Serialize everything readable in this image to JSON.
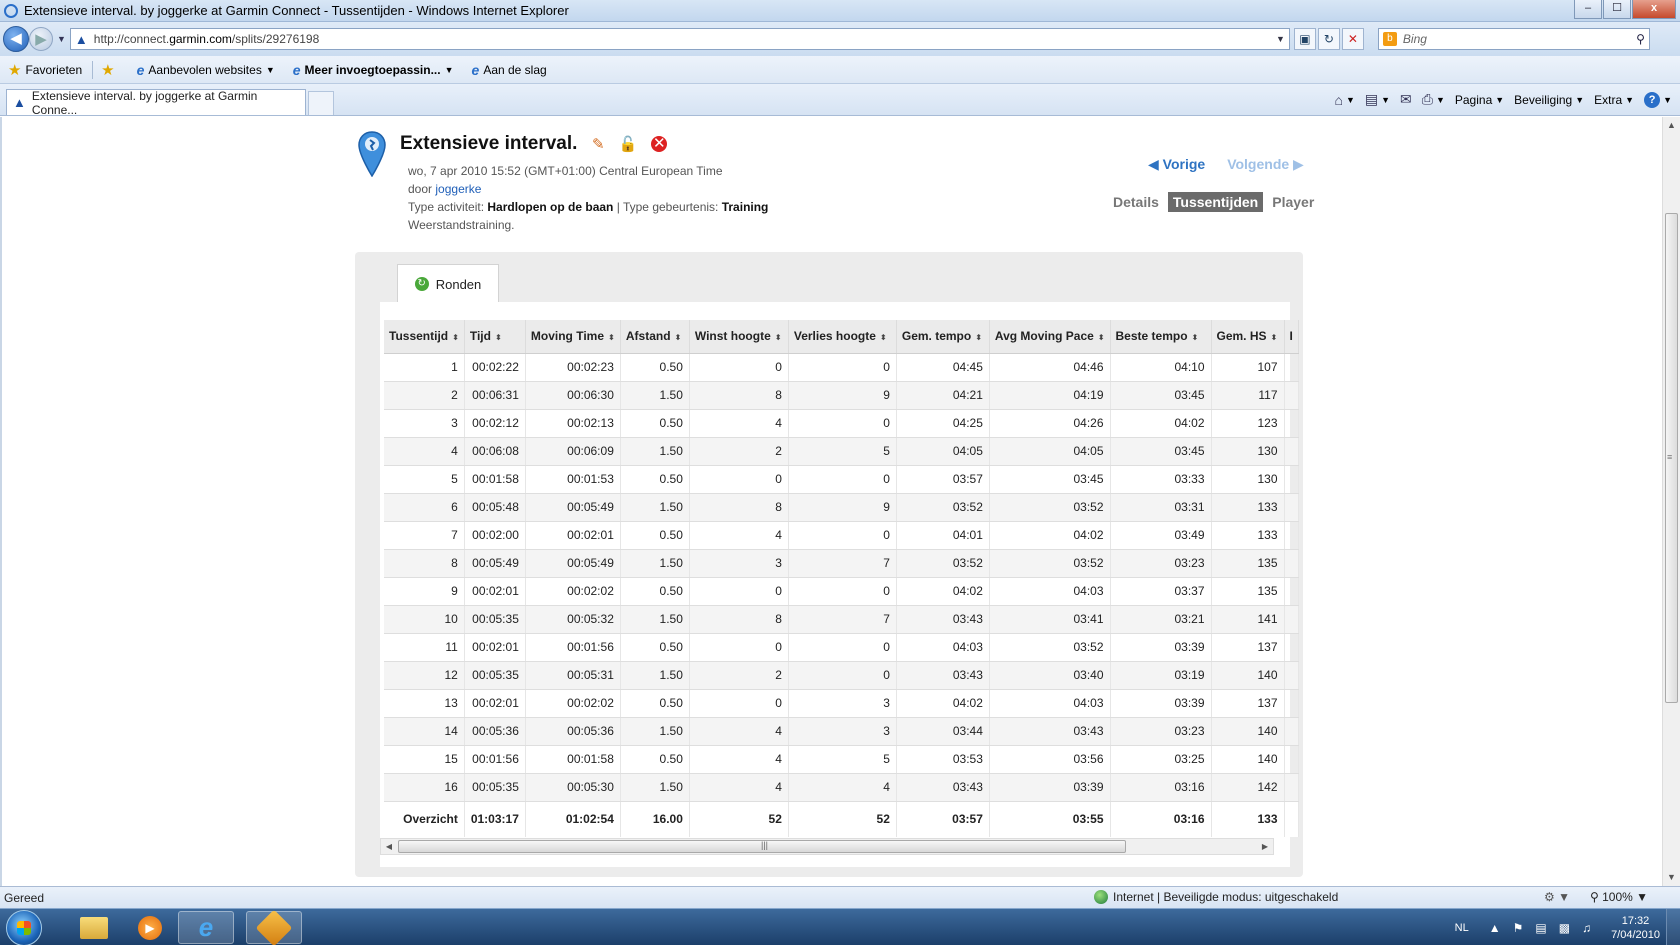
{
  "window": {
    "title": "Extensieve interval. by joggerke at Garmin Connect - Tussentijden - Windows Internet Explorer",
    "min": "–",
    "max": "☐",
    "close": "x"
  },
  "address": {
    "url_prefix": "http://connect.",
    "url_domain": "garmin.com",
    "url_path": "/splits/29276198",
    "search_placeholder": "Bing"
  },
  "favorites": {
    "favorites_label": "Favorieten",
    "recommended": "Aanbevolen websites",
    "addons": "Meer invoegtoepassin...",
    "get_started": "Aan de slag"
  },
  "tabs": {
    "active_tab": "Extensieve interval. by joggerke at Garmin Conne..."
  },
  "commandbar": {
    "page": "Pagina",
    "safety": "Beveiliging",
    "tools": "Extra",
    "help": "?"
  },
  "activity": {
    "title": "Extensieve interval.",
    "date": "wo, 7 apr 2010 15:52 (GMT+01:00) Central European Time",
    "by_prefix": "door",
    "user": "joggerke",
    "type_label": "Type activiteit:",
    "type_value": "Hardlopen op de baan",
    "event_label": "| Type gebeurtenis:",
    "event_value": "Training",
    "description": "Weerstandstraining."
  },
  "navigation": {
    "previous": "Vorige",
    "next": "Volgende",
    "view_details": "Details",
    "view_splits": "Tussentijden",
    "view_player": "Player"
  },
  "splits_panel": {
    "tab_label": "Ronden",
    "columns": [
      "Tussentijd",
      "Tijd",
      "Moving Time",
      "Afstand",
      "Winst hoogte",
      "Verlies hoogte",
      "Gem. tempo",
      "Avg Moving Pace",
      "Beste tempo",
      "Gem. HS",
      "I"
    ],
    "rows": [
      [
        "1",
        "00:02:22",
        "00:02:23",
        "0.50",
        "0",
        "0",
        "04:45",
        "04:46",
        "04:10",
        "107"
      ],
      [
        "2",
        "00:06:31",
        "00:06:30",
        "1.50",
        "8",
        "9",
        "04:21",
        "04:19",
        "03:45",
        "117"
      ],
      [
        "3",
        "00:02:12",
        "00:02:13",
        "0.50",
        "4",
        "0",
        "04:25",
        "04:26",
        "04:02",
        "123"
      ],
      [
        "4",
        "00:06:08",
        "00:06:09",
        "1.50",
        "2",
        "5",
        "04:05",
        "04:05",
        "03:45",
        "130"
      ],
      [
        "5",
        "00:01:58",
        "00:01:53",
        "0.50",
        "0",
        "0",
        "03:57",
        "03:45",
        "03:33",
        "130"
      ],
      [
        "6",
        "00:05:48",
        "00:05:49",
        "1.50",
        "8",
        "9",
        "03:52",
        "03:52",
        "03:31",
        "133"
      ],
      [
        "7",
        "00:02:00",
        "00:02:01",
        "0.50",
        "4",
        "0",
        "04:01",
        "04:02",
        "03:49",
        "133"
      ],
      [
        "8",
        "00:05:49",
        "00:05:49",
        "1.50",
        "3",
        "7",
        "03:52",
        "03:52",
        "03:23",
        "135"
      ],
      [
        "9",
        "00:02:01",
        "00:02:02",
        "0.50",
        "0",
        "0",
        "04:02",
        "04:03",
        "03:37",
        "135"
      ],
      [
        "10",
        "00:05:35",
        "00:05:32",
        "1.50",
        "8",
        "7",
        "03:43",
        "03:41",
        "03:21",
        "141"
      ],
      [
        "11",
        "00:02:01",
        "00:01:56",
        "0.50",
        "0",
        "0",
        "04:03",
        "03:52",
        "03:39",
        "137"
      ],
      [
        "12",
        "00:05:35",
        "00:05:31",
        "1.50",
        "2",
        "0",
        "03:43",
        "03:40",
        "03:19",
        "140"
      ],
      [
        "13",
        "00:02:01",
        "00:02:02",
        "0.50",
        "0",
        "3",
        "04:02",
        "04:03",
        "03:39",
        "137"
      ],
      [
        "14",
        "00:05:36",
        "00:05:36",
        "1.50",
        "4",
        "3",
        "03:44",
        "03:43",
        "03:23",
        "140"
      ],
      [
        "15",
        "00:01:56",
        "00:01:58",
        "0.50",
        "4",
        "5",
        "03:53",
        "03:56",
        "03:25",
        "140"
      ],
      [
        "16",
        "00:05:35",
        "00:05:30",
        "1.50",
        "4",
        "4",
        "03:43",
        "03:39",
        "03:16",
        "142"
      ]
    ],
    "summary": [
      "Overzicht",
      "01:03:17",
      "01:02:54",
      "16.00",
      "52",
      "52",
      "03:57",
      "03:55",
      "03:16",
      "133"
    ]
  },
  "statusbar": {
    "status": "Gereed",
    "zone": "Internet | Beveiligde modus: uitgeschakeld",
    "zoom": "100%"
  },
  "taskbar": {
    "language": "NL",
    "time": "17:32",
    "date": "7/04/2010"
  }
}
